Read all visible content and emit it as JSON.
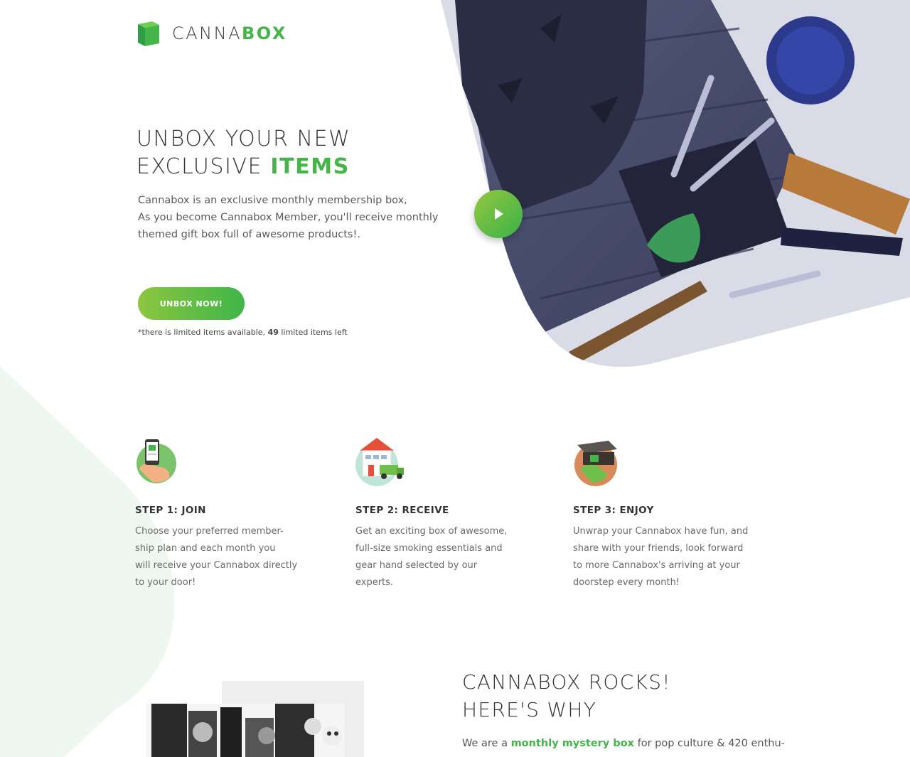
{
  "brand": {
    "name_light": "CANNA",
    "name_bold": "BOX"
  },
  "hero": {
    "title_line1": "UNBOX YOUR NEW",
    "title_line2_light": "EXCLUSIVE ",
    "title_line2_bold": "ITEMS",
    "desc_line1": "Cannabox is an exclusive monthly membership box,",
    "desc_line2": "As you become Cannabox Member, you'll receive monthly",
    "desc_line3": "themed gift box full of awesome products!.",
    "cta_label": "UNBOX NOW!",
    "stock_prefix": "*there is limited items available, ",
    "stock_count": "49",
    "stock_suffix": " limited items left"
  },
  "steps": [
    {
      "title": "STEP 1: JOIN",
      "lines": [
        "Choose your preferred member-",
        "ship plan and each month you",
        "will receive your Cannabox directly",
        "to your door!"
      ]
    },
    {
      "title": "STEP 2: RECEIVE",
      "lines": [
        "Get an exciting box of awesome,",
        "full-size smoking essentials and",
        "gear hand selected by our",
        "experts."
      ]
    },
    {
      "title": "STEP 3: ENJOY",
      "lines": [
        "Unwrap your Cannabox have fun, and",
        "share with your friends, look forward",
        "to more Cannabox's arriving at your",
        "doorstep every month!"
      ]
    }
  ],
  "rocks": {
    "title_line1": "CANNABOX ROCKS!",
    "title_line2": "HERE'S WHY",
    "text_prefix": "We are a ",
    "text_highlight": "monthly mystery box",
    "text_suffix": " for pop culture & 420 enthu-"
  },
  "colors": {
    "accent": "#45b549",
    "accent_light": "#8cc63f",
    "photo_tint": "#3c3f62",
    "bg_shape": "#eef7f0"
  }
}
